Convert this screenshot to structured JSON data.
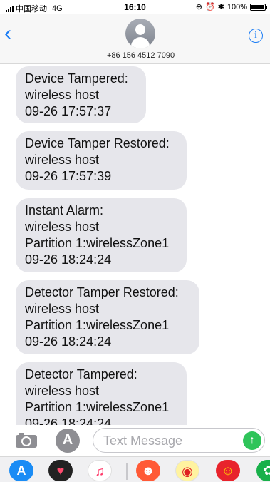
{
  "status_bar": {
    "carrier": "中国移动",
    "network": "4G",
    "time": "16:10",
    "battery": "100%",
    "battery_fraction": 1.0
  },
  "header": {
    "back_icon": "chevron-left-icon",
    "phone_number": "+86 156 4512 7090",
    "info_icon": "info-icon",
    "info_glyph": "i"
  },
  "messages": [
    {
      "text": "Device Tampered:\nwireless host\n09-26 17:57:37"
    },
    {
      "text": "Device Tamper Restored:\nwireless host\n09-26 17:57:39"
    },
    {
      "text": "Instant Alarm:\nwireless host\nPartition 1:wirelessZone1\n09-26 18:24:24"
    },
    {
      "text": "Detector Tamper Restored:\nwireless host\nPartition 1:wirelessZone1\n09-26 18:24:24"
    },
    {
      "text": "Detector Tampered:\nwireless host\nPartition 1:wirelessZone1\n09-26 18:24:24"
    }
  ],
  "input_bar": {
    "placeholder": "Text Message",
    "value": ""
  },
  "app_drawer": {
    "apps": [
      "app-store-icon",
      "digital-touch-icon",
      "music-icon",
      "separator",
      "gestures-app-icon",
      "weibo-icon",
      "suning-icon",
      "green-app-icon"
    ]
  },
  "colors": {
    "accent": "#1a7cf5",
    "bubble": "#e6e6eb",
    "send": "#2fc45a"
  }
}
